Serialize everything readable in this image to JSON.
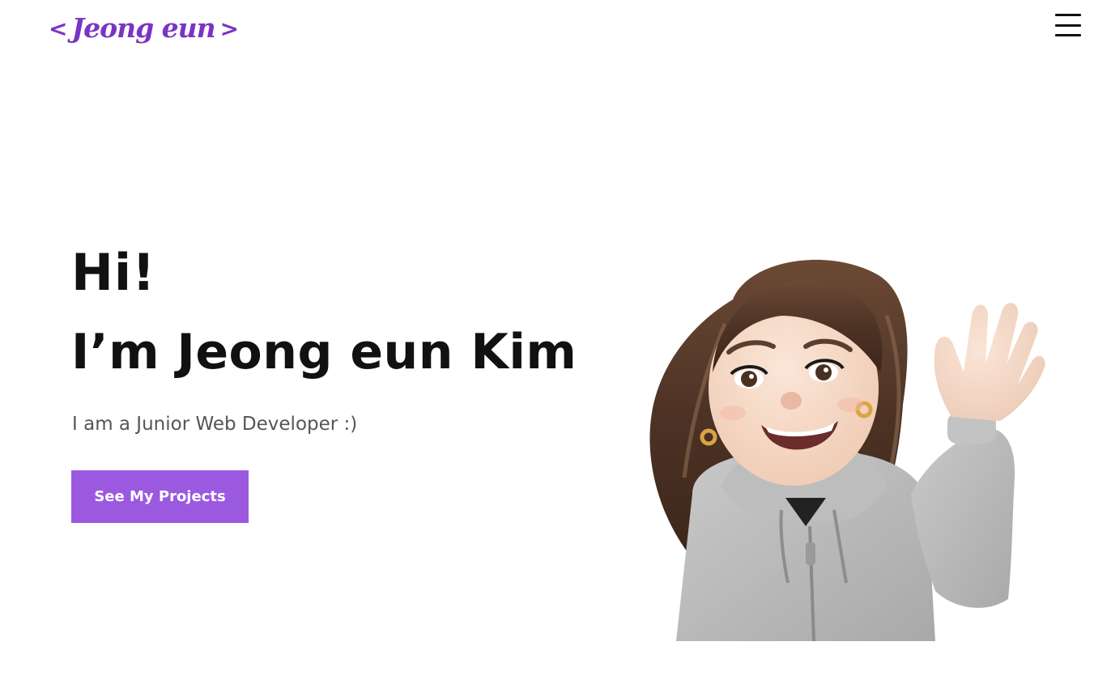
{
  "header": {
    "logo_text": "Jeong eun",
    "logo_bracket_left": "<",
    "logo_bracket_right": ">",
    "menu_icon": "hamburger-menu-icon"
  },
  "hero": {
    "greeting": "Hi!",
    "name_line": "I’m Jeong eun Kim",
    "subtitle": "I am a Junior Web Developer :)",
    "cta_label": "See My Projects",
    "avatar_icon": "memoji-waving-avatar"
  },
  "colors": {
    "accent": "#9b59e0",
    "logo": "#7a34c4",
    "heading": "#111111",
    "subtitle": "#555555",
    "background": "#ffffff"
  }
}
